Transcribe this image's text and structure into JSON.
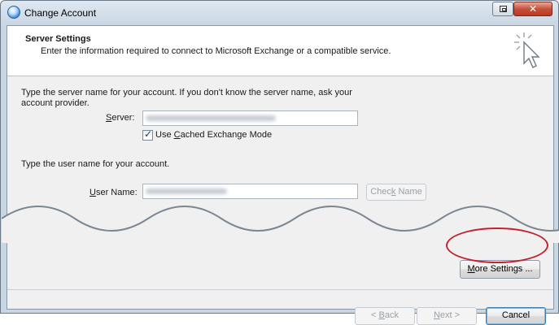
{
  "window": {
    "title": "Change Account",
    "close_glyph": "✕"
  },
  "header": {
    "title": "Server Settings",
    "description": "Enter the information required to connect to Microsoft Exchange or a compatible service."
  },
  "server_section": {
    "instructions": "Type the server name for your account. If you don't know the server name, ask your account provider.",
    "server_label": "Server:",
    "server_value_blurred": true,
    "cached_mode_label": "Use Cached Exchange Mode",
    "cached_mode_checked": true
  },
  "user_section": {
    "instructions": "Type the user name for your account.",
    "user_label": "User Name:",
    "user_value_blurred": true,
    "check_name_label": "Check Name"
  },
  "buttons": {
    "more_settings": "More Settings ...",
    "back": "< Back",
    "next": "Next >",
    "cancel": "Cancel"
  },
  "colors": {
    "highlight_ellipse": "#c4222e"
  },
  "icons": {
    "header": "cursor-sparkle-icon",
    "app": "outlook-globe-icon"
  }
}
